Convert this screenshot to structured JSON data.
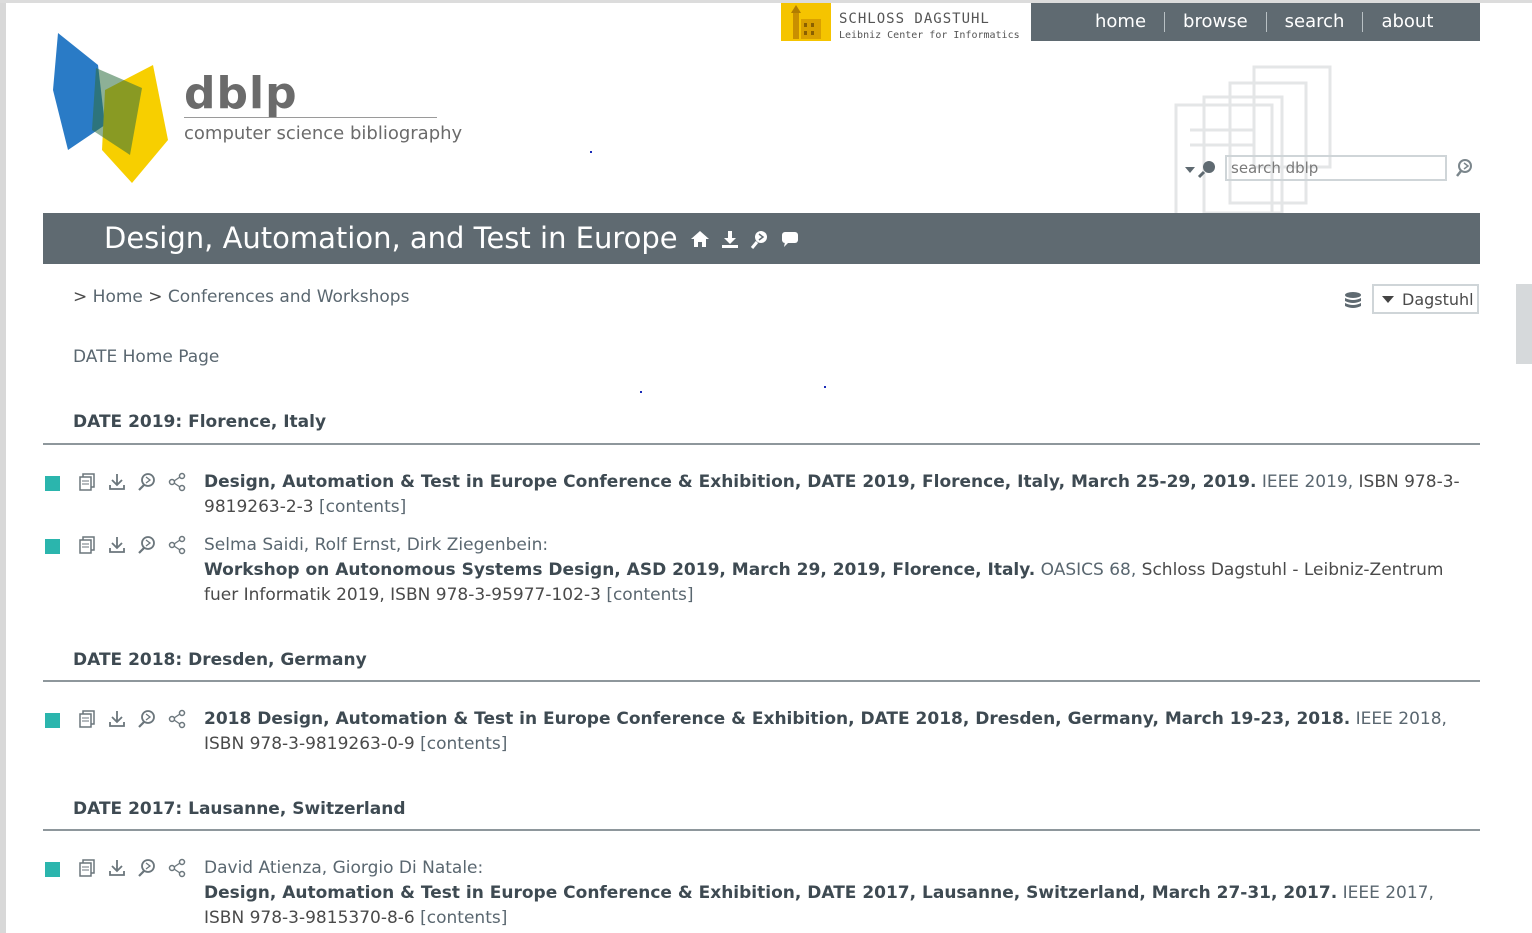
{
  "header": {
    "dagstuhl_name": "SCHLOSS DAGSTUHL",
    "dagstuhl_sub": "Leibniz Center for Informatics",
    "nav": [
      "home",
      "browse",
      "search",
      "about"
    ],
    "logo_word": "dblp",
    "logo_sub": "computer science bibliography",
    "search_placeholder": "search dblp"
  },
  "page": {
    "title": "Design, Automation, and Test in Europe",
    "breadcrumb_prefix": ">",
    "breadcrumb_home": "Home",
    "breadcrumb_sep": ">",
    "breadcrumb_section": "Conferences and Workshops",
    "mirror": "Dagstuhl",
    "home_page_link": "DATE Home Page"
  },
  "sections": [
    {
      "heading": "DATE 2019: Florence, Italy",
      "entries": [
        {
          "authors": "",
          "title": "Design, Automation & Test in Europe Conference & Exhibition, DATE 2019, Florence, Italy, March 25-29, 2019.",
          "venue": "IEEE 2019,",
          "isbn": "ISBN 978-3-9819263-2-3",
          "contents": "[contents]"
        },
        {
          "authors": "Selma Saidi, Rolf Ernst, Dirk Ziegenbein:",
          "title": "Workshop on Autonomous Systems Design, ASD 2019, March 29, 2019, Florence, Italy.",
          "venue": "OASICS 68,",
          "isbn": "Schloss Dagstuhl - Leibniz-Zentrum fuer Informatik 2019, ISBN 978-3-95977-102-3",
          "contents": "[contents]"
        }
      ]
    },
    {
      "heading": "DATE 2018: Dresden, Germany",
      "entries": [
        {
          "authors": "",
          "title": "2018 Design, Automation & Test in Europe Conference & Exhibition, DATE 2018, Dresden, Germany, March 19-23, 2018.",
          "venue": "IEEE 2018,",
          "isbn": "ISBN 978-3-9819263-0-9",
          "contents": "[contents]"
        }
      ]
    },
    {
      "heading": "DATE 2017: Lausanne, Switzerland",
      "entries": [
        {
          "authors": "David Atienza, Giorgio Di Natale:",
          "title": "Design, Automation & Test in Europe Conference & Exhibition, DATE 2017, Lausanne, Switzerland, March 27-31, 2017.",
          "venue": "IEEE 2017,",
          "isbn": "ISBN 978-3-9815370-8-6",
          "contents": "[contents]"
        }
      ]
    }
  ],
  "colors": {
    "nav_bg": "#5f6a71",
    "accent_square": "#2bb5ad",
    "dagstuhl_yellow": "#f5c400",
    "logo_blue": "#2a7bc6",
    "logo_yellow": "#f7cf00"
  }
}
